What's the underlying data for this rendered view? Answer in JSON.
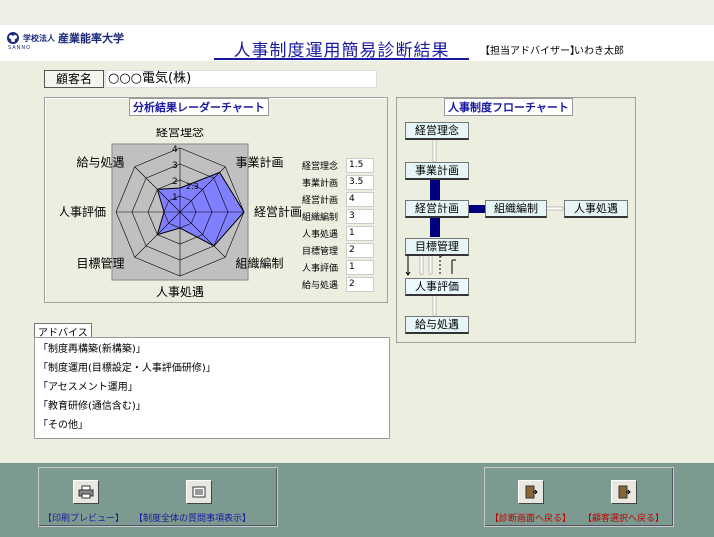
{
  "header": {
    "logo_prefix": "学校法人",
    "logo_name": "産業能率大学",
    "logo_sub": "SANNO",
    "title": "人事制度運用簡易診断結果",
    "advisor_label": "【担当アドバイザー】",
    "advisor_name": "いわき太郎"
  },
  "client": {
    "label": "顧客名",
    "name": "○○○電気(株)"
  },
  "radar": {
    "title": "分析結果レーダーチャート",
    "axes": [
      "経営理念",
      "事業計画",
      "経営計画",
      "組織編制",
      "人事処遇",
      "目標管理",
      "人事評価",
      "給与処遇"
    ],
    "rings": [
      "1",
      "2",
      "3",
      "4"
    ],
    "ring_small_labels": [
      "2.3"
    ],
    "colors": {
      "fill": "#8080ff",
      "bg": "#c0c0c0",
      "grid": "#000000"
    }
  },
  "chart_data": {
    "type": "radar",
    "title": "分析結果レーダーチャート",
    "categories": [
      "経営理念",
      "事業計画",
      "経営計画",
      "組織編制",
      "人事処遇",
      "目標管理",
      "人事評価",
      "給与処遇"
    ],
    "values": [
      1.5,
      3.5,
      4,
      3,
      1,
      2,
      1,
      2
    ],
    "rmax": 4
  },
  "scores": [
    {
      "label": "経営理念",
      "value": "1.5"
    },
    {
      "label": "事業計画",
      "value": "3.5"
    },
    {
      "label": "経営計画",
      "value": "4"
    },
    {
      "label": "組織編制",
      "value": "3"
    },
    {
      "label": "人事処遇",
      "value": "1"
    },
    {
      "label": "目標管理",
      "value": "2"
    },
    {
      "label": "人事評価",
      "value": "1"
    },
    {
      "label": "給与処遇",
      "value": "2"
    }
  ],
  "flow": {
    "title": "人事制度フローチャート",
    "nodes": {
      "rinen": "経営理念",
      "jigyo": "事業計画",
      "keiei": "経営計画",
      "soshiki": "組織編制",
      "shogu": "人事処遇",
      "mokuhyo": "目標管理",
      "hyoka": "人事評価",
      "kyuyo": "給与処遇"
    }
  },
  "advice": {
    "label": "アドバイス",
    "items": [
      "「制度再構築(新構築)」",
      "「制度運用(目標設定・人事評価研修)」",
      "「アセスメント運用」",
      "「教育研修(通信含む)」",
      "「その他」"
    ]
  },
  "buttons": {
    "print_preview": "【印刷プレビュー】",
    "show_questions": "【制度全体の質問事項表示】",
    "back_diagnosis": "【診断画面へ戻る】",
    "back_client": "【顧客選択へ戻る】"
  }
}
